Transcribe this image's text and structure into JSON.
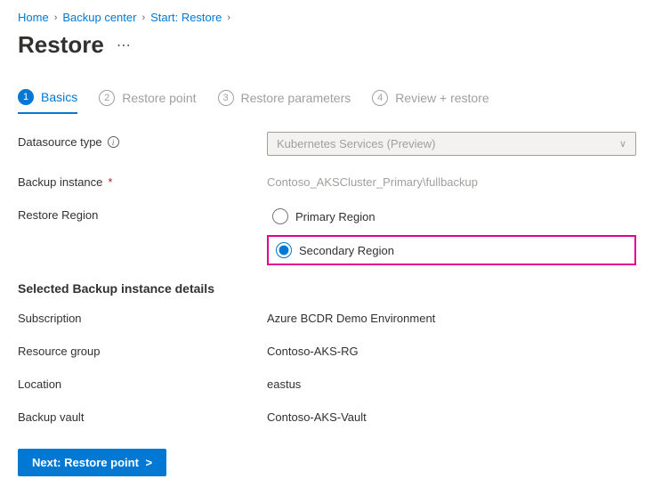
{
  "breadcrumb": {
    "items": [
      "Home",
      "Backup center",
      "Start: Restore"
    ]
  },
  "page": {
    "title": "Restore"
  },
  "tabs": {
    "t1": {
      "num": "1",
      "label": "Basics"
    },
    "t2": {
      "num": "2",
      "label": "Restore point"
    },
    "t3": {
      "num": "3",
      "label": "Restore parameters"
    },
    "t4": {
      "num": "4",
      "label": "Review + restore"
    }
  },
  "form": {
    "datasource_type_label": "Datasource type",
    "datasource_type_value": "Kubernetes Services (Preview)",
    "backup_instance_label": "Backup instance",
    "backup_instance_value": "Contoso_AKSCluster_Primary\\fullbackup",
    "restore_region_label": "Restore Region",
    "region_primary": "Primary Region",
    "region_secondary": "Secondary Region"
  },
  "details": {
    "section_title": "Selected Backup instance details",
    "subscription_label": "Subscription",
    "subscription_value": "Azure BCDR Demo Environment",
    "rg_label": "Resource group",
    "rg_value": "Contoso-AKS-RG",
    "location_label": "Location",
    "location_value": "eastus",
    "vault_label": "Backup vault",
    "vault_value": "Contoso-AKS-Vault"
  },
  "footer": {
    "next_label": "Next: Restore point"
  }
}
